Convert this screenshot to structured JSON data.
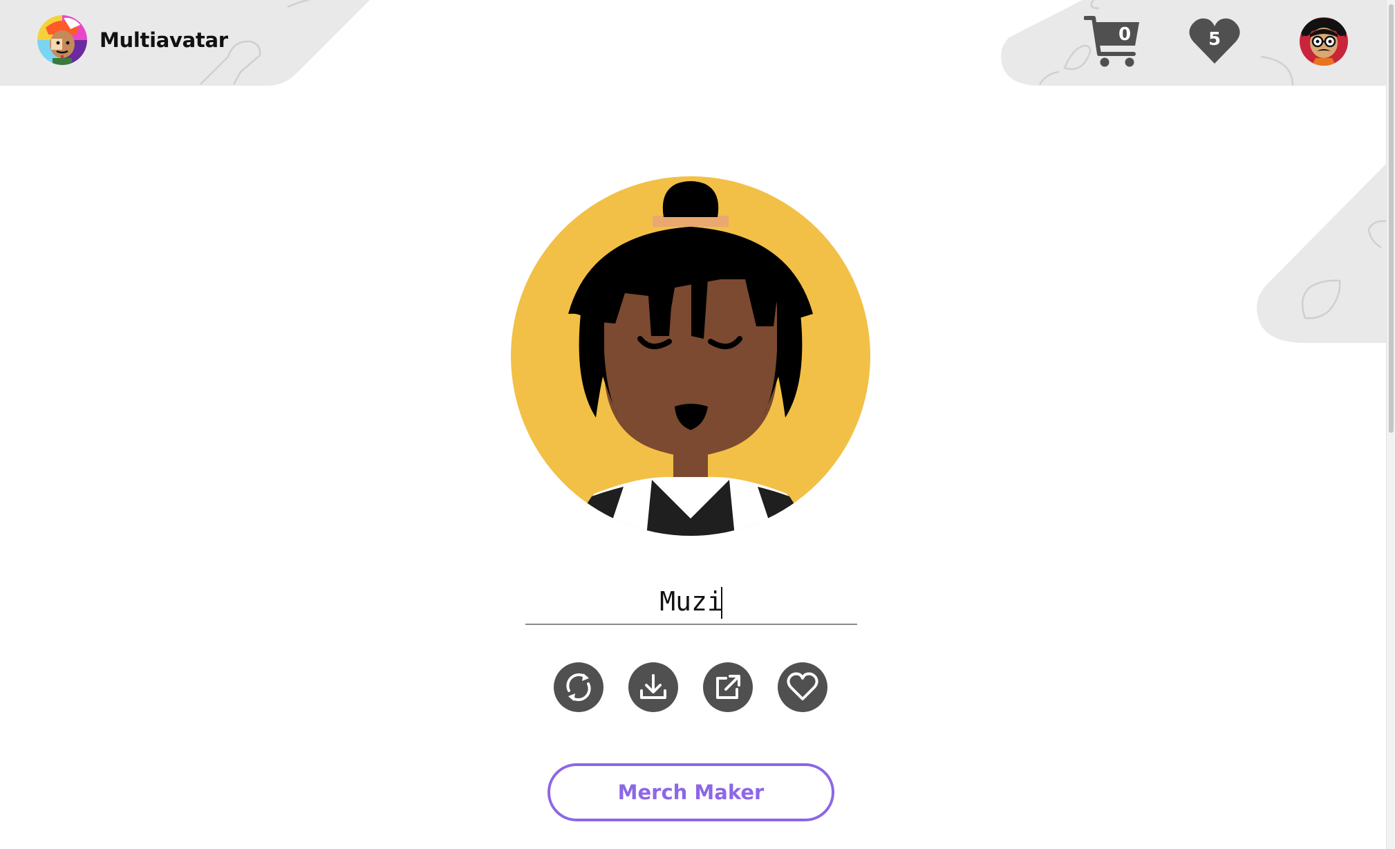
{
  "header": {
    "logo_title": "Multiavatar",
    "cart_count": "0",
    "favorites_count": "5"
  },
  "avatar_name_input": {
    "value": "Muzi"
  },
  "actions": [
    {
      "icon": "refresh-icon"
    },
    {
      "icon": "download-icon"
    },
    {
      "icon": "share-icon"
    },
    {
      "icon": "heart-icon"
    }
  ],
  "merch_button_label": "Merch Maker",
  "colors": {
    "header_shape": "#e9e9e9",
    "icon_gray": "#505050",
    "accent_purple": "#8c67e6",
    "avatar_background": "#f2c046",
    "skin": "#7b4a30",
    "hair": "#000000"
  }
}
